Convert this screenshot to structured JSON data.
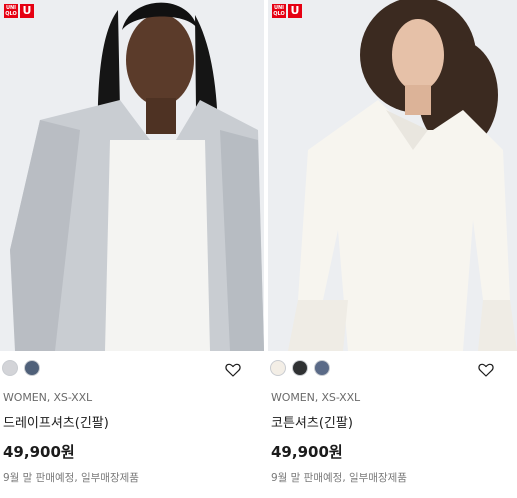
{
  "brand": {
    "logo_top_left": "UNI",
    "logo_bottom_left": "QLO",
    "logo_right": "U",
    "color": "#e60012"
  },
  "products": [
    {
      "swatches": [
        "#d3d4d8",
        "#4f6079"
      ],
      "category": "WOMEN, XS-XXL",
      "name": "드레이프셔츠(긴팔)",
      "price": "49,900원",
      "note": "9월 말 판매예정, 일부매장제품",
      "wishlist_icon": "heart-outline-icon"
    },
    {
      "swatches": [
        "#f3eee6",
        "#2f3133",
        "#5a6a87"
      ],
      "category": "WOMEN, XS-XXL",
      "name": "코튼셔츠(긴팔)",
      "price": "49,900원",
      "note": "9월 말 판매예정, 일부매장제품",
      "wishlist_icon": "heart-outline-icon"
    }
  ]
}
